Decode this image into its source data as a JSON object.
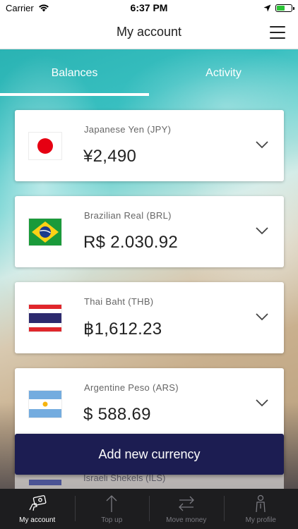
{
  "status_bar": {
    "carrier": "Carrier",
    "time": "6:37 PM",
    "battery_level": 0.55
  },
  "nav": {
    "title": "My account"
  },
  "tabs": [
    {
      "label": "Balances",
      "active": true
    },
    {
      "label": "Activity",
      "active": false
    }
  ],
  "currencies": [
    {
      "name": "Japanese Yen (JPY)",
      "amount": "¥2,490",
      "flag": "japan-flag"
    },
    {
      "name": "Brazilian Real (BRL)",
      "amount": "R$ 2.030.92",
      "flag": "brazil-flag"
    },
    {
      "name": "Thai Baht (THB)",
      "amount": "฿1,612.23",
      "flag": "thailand-flag"
    },
    {
      "name": "Argentine Peso (ARS)",
      "amount": "$ 588.69",
      "flag": "argentina-flag"
    }
  ],
  "peek": {
    "label": "Israeli Shekels (ILS)"
  },
  "add_button": {
    "label": "Add new currency"
  },
  "tab_bar": [
    {
      "label": "My account",
      "icon": "wallet-icon",
      "active": true
    },
    {
      "label": "Top up",
      "icon": "arrow-up-icon",
      "active": false
    },
    {
      "label": "Move money",
      "icon": "transfer-icon",
      "active": false
    },
    {
      "label": "My profile",
      "icon": "person-icon",
      "active": false
    }
  ],
  "colors": {
    "accent": "#1c1d52",
    "tab_bar": "#1d1d1f"
  }
}
